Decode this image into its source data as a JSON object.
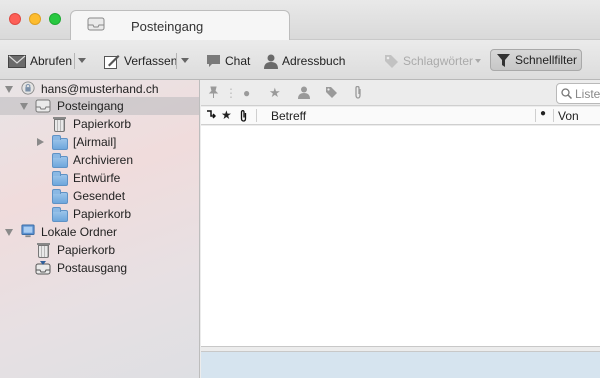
{
  "tab": {
    "title": "Posteingang"
  },
  "toolbar": {
    "get_messages": "Abrufen",
    "compose": "Verfassen",
    "chat": "Chat",
    "address_book": "Adressbuch",
    "tags": "Schlagwörter",
    "quick_filter": "Schnellfilter"
  },
  "folders": {
    "account": "hans@musterhand.ch",
    "inbox": "Posteingang",
    "items": [
      "Papierkorb",
      "[Airmail]",
      "Archivieren",
      "Entwürfe",
      "Gesendet",
      "Papierkorb"
    ],
    "local": "Lokale Ordner",
    "local_items": [
      "Papierkorb",
      "Postausgang"
    ]
  },
  "search": {
    "placeholder": "Liste"
  },
  "columns": {
    "subject": "Betreff",
    "from": "Von"
  },
  "colors": {
    "accent_blue": "#5f92c5",
    "selection_gray": "#c0c0c5"
  }
}
